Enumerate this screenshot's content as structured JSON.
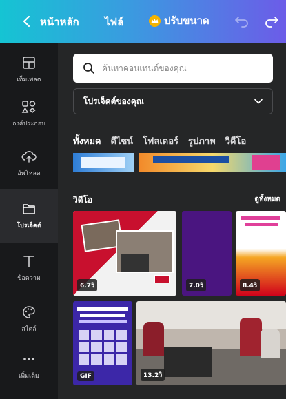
{
  "topbar": {
    "home_label": "หน้าหลัก",
    "file_label": "ไฟล์",
    "resize_label": "ปรับขนาด",
    "gradient_colors": [
      "#15c4d3",
      "#6c5ce8"
    ]
  },
  "rail": {
    "items": [
      {
        "label": "เท็มเพลต",
        "icon": "template-icon"
      },
      {
        "label": "องค์ประกอบ",
        "icon": "elements-icon"
      },
      {
        "label": "อัพโหลด",
        "icon": "upload-cloud-icon"
      },
      {
        "label": "โปรเจ็คต์",
        "icon": "folder-icon"
      },
      {
        "label": "ข้อความ",
        "icon": "text-icon"
      },
      {
        "label": "สไตล์",
        "icon": "palette-icon"
      },
      {
        "label": "เพิ่มเติม",
        "icon": "more-dots-icon"
      }
    ],
    "active_index": 3
  },
  "panel": {
    "search_placeholder": "ค้นหาคอนเทนต์ของคุณ",
    "select_value": "โปรเจ็คต์ของคุณ",
    "tabs": [
      "ทั้งหมด",
      "ดีไซน์",
      "โฟลเดอร์",
      "รูปภาพ",
      "วิดีโอ"
    ],
    "active_tab": 0,
    "section_title": "วิดีโอ",
    "see_all": "ดูทั้งหมด",
    "videos": [
      {
        "duration": "6.7วิ"
      },
      {
        "duration": "7.0วิ"
      },
      {
        "duration": "8.4วิ"
      },
      {
        "duration": "GIF"
      },
      {
        "duration": "13.2วิ"
      }
    ]
  }
}
